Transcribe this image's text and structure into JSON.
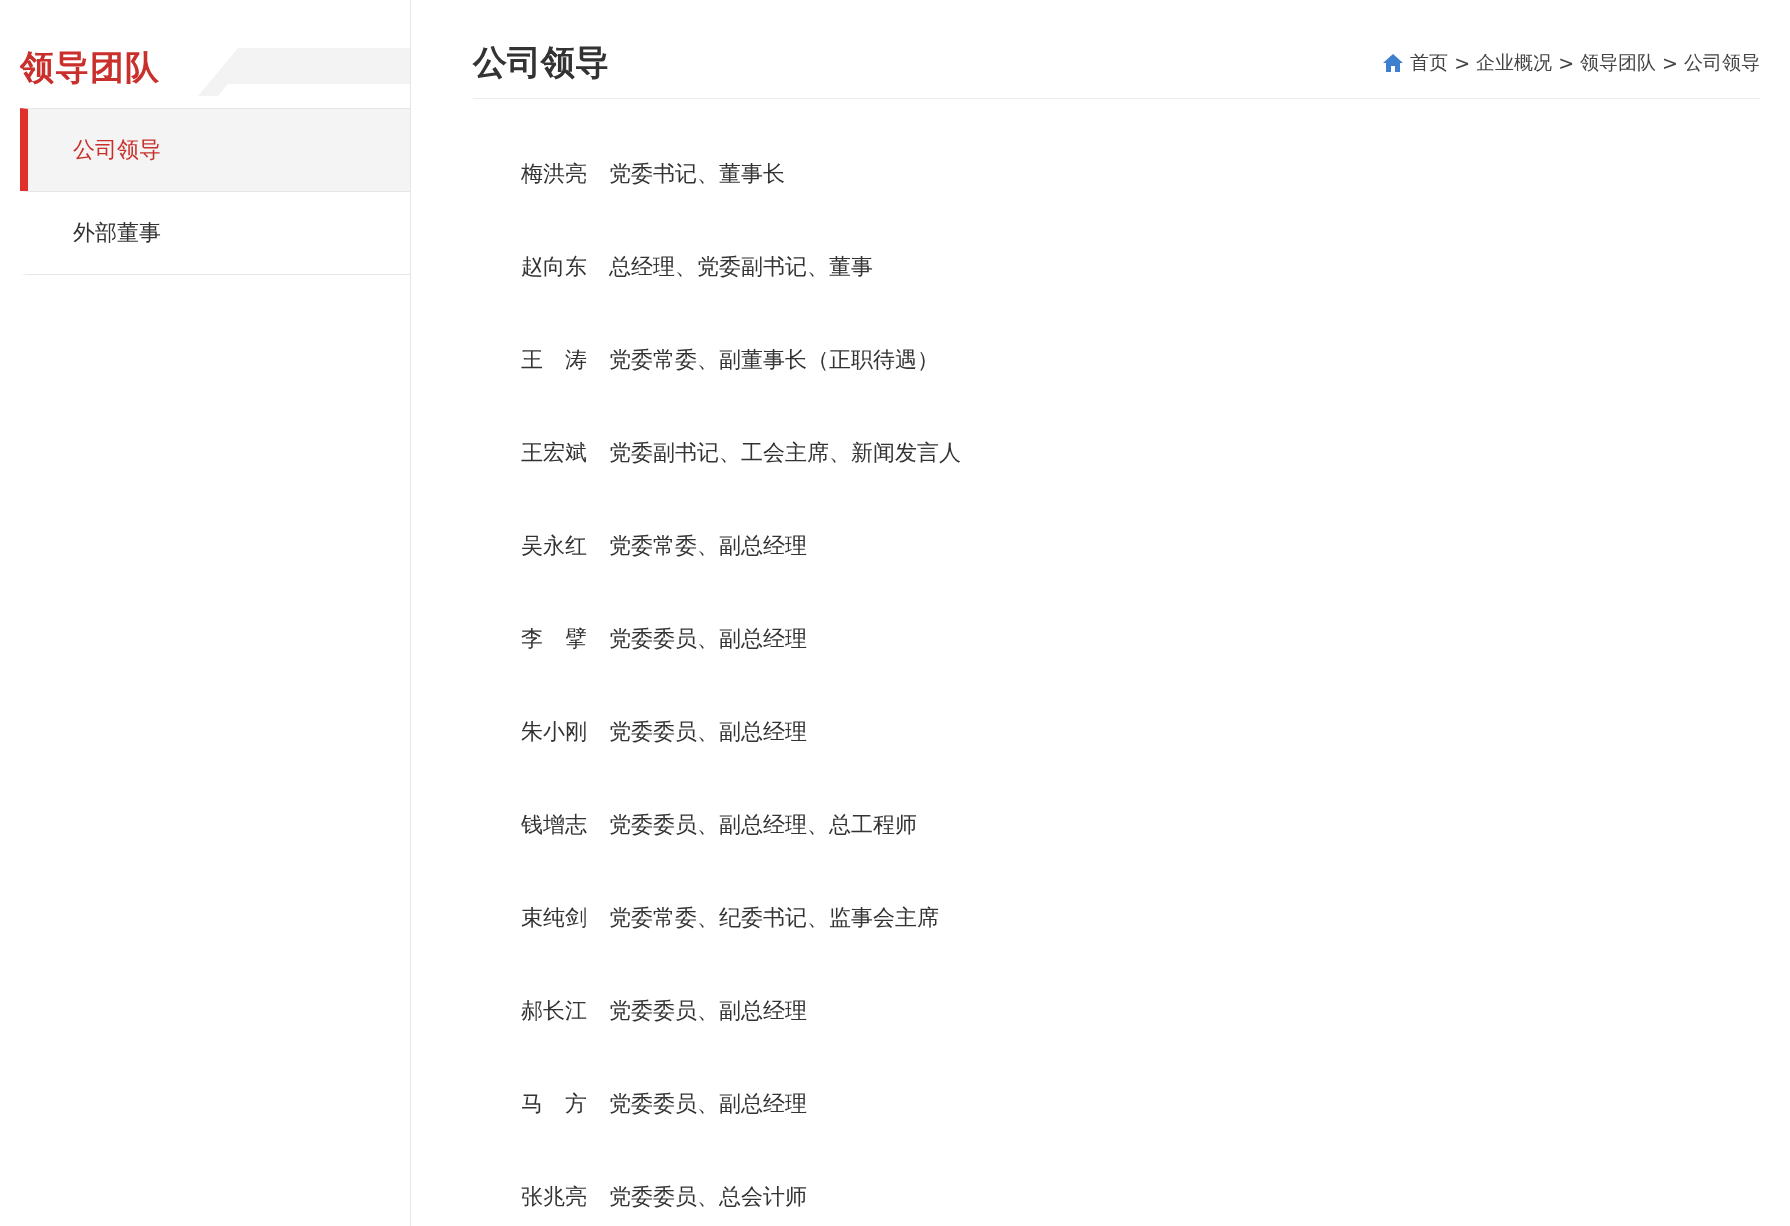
{
  "sidebar": {
    "title": "领导团队",
    "items": [
      {
        "label": "公司领导",
        "selected": true
      },
      {
        "label": "外部董事",
        "selected": false
      }
    ]
  },
  "header": {
    "title": "公司领导",
    "breadcrumb": [
      "首页",
      "企业概况",
      "领导团队",
      "公司领导"
    ],
    "separator": ">"
  },
  "leaders": [
    {
      "name": "梅洪亮",
      "position": "党委书记、董事长"
    },
    {
      "name": "赵向东",
      "position": "总经理、党委副书记、董事"
    },
    {
      "name": "王　涛",
      "position": "党委常委、副董事长（正职待遇）"
    },
    {
      "name": "王宏斌",
      "position": "党委副书记、工会主席、新闻发言人"
    },
    {
      "name": "吴永红",
      "position": "党委常委、副总经理"
    },
    {
      "name": "李　擘",
      "position": "党委委员、副总经理"
    },
    {
      "name": "朱小刚",
      "position": "党委委员、副总经理"
    },
    {
      "name": "钱增志",
      "position": "党委委员、副总经理、总工程师"
    },
    {
      "name": "束纯剑",
      "position": "党委常委、纪委书记、监事会主席"
    },
    {
      "name": "郝长江",
      "position": "党委委员、副总经理"
    },
    {
      "name": "马　方",
      "position": "党委委员、副总经理"
    },
    {
      "name": "张兆亮",
      "position": "党委委员、总会计师"
    }
  ]
}
